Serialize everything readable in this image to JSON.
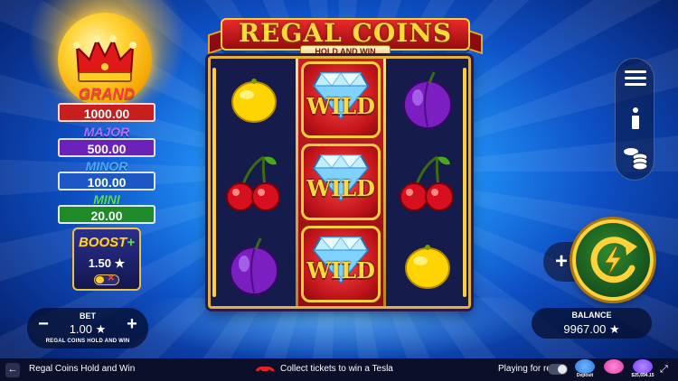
{
  "game": {
    "title": "REGAL COINS",
    "subtitle": "HOLD AND WIN"
  },
  "jackpots": [
    {
      "name": "GRAND",
      "value": "1000.00",
      "label_color": "#ff3b3b",
      "box_color": "#c81e1e"
    },
    {
      "name": "MAJOR",
      "value": "500.00",
      "label_color": "#b66bff",
      "box_color": "#6a22b8"
    },
    {
      "name": "MINOR",
      "value": "100.00",
      "label_color": "#4aa8ff",
      "box_color": "#1c57c4"
    },
    {
      "name": "MINI",
      "value": "20.00",
      "label_color": "#58e04a",
      "box_color": "#1f8a2a"
    }
  ],
  "boost": {
    "title": "BOOST",
    "plus": "+",
    "value": "1.50 ★"
  },
  "reels": {
    "left": [
      "lemon",
      "cherry",
      "plum"
    ],
    "middle_wild_label": "WILD",
    "right": [
      "plum",
      "cherry",
      "lemon"
    ]
  },
  "bet": {
    "label": "BET",
    "value": "1.00 ★",
    "game_name": "REGAL COINS HOLD AND WIN",
    "minus": "−",
    "plus": "+"
  },
  "balance": {
    "label": "BALANCE",
    "value": "9967.00 ★"
  },
  "controls": {
    "menu_icon": "hamburger-icon",
    "info_icon": "info-icon",
    "coins_icon": "coins-stack-icon",
    "add_label": "+",
    "spin_icon": "spin-lightning-icon"
  },
  "bottom_bar": {
    "back": "←",
    "game_name": "Regal Coins Hold and Win",
    "promo_text": "Collect tickets to win a Tesla",
    "playing_for_real": "Playing for real",
    "badges": [
      {
        "label": "Deposit",
        "color": "#2d7be0"
      },
      {
        "label": "",
        "color": "#e03aa8"
      },
      {
        "label": "$25,694.15",
        "color": "#7a3cff"
      }
    ],
    "expand": "⤢"
  },
  "colors": {
    "accent_gold": "#ffd23a",
    "reel_bg": "#151b4a",
    "wild_red": "#c81d22"
  }
}
